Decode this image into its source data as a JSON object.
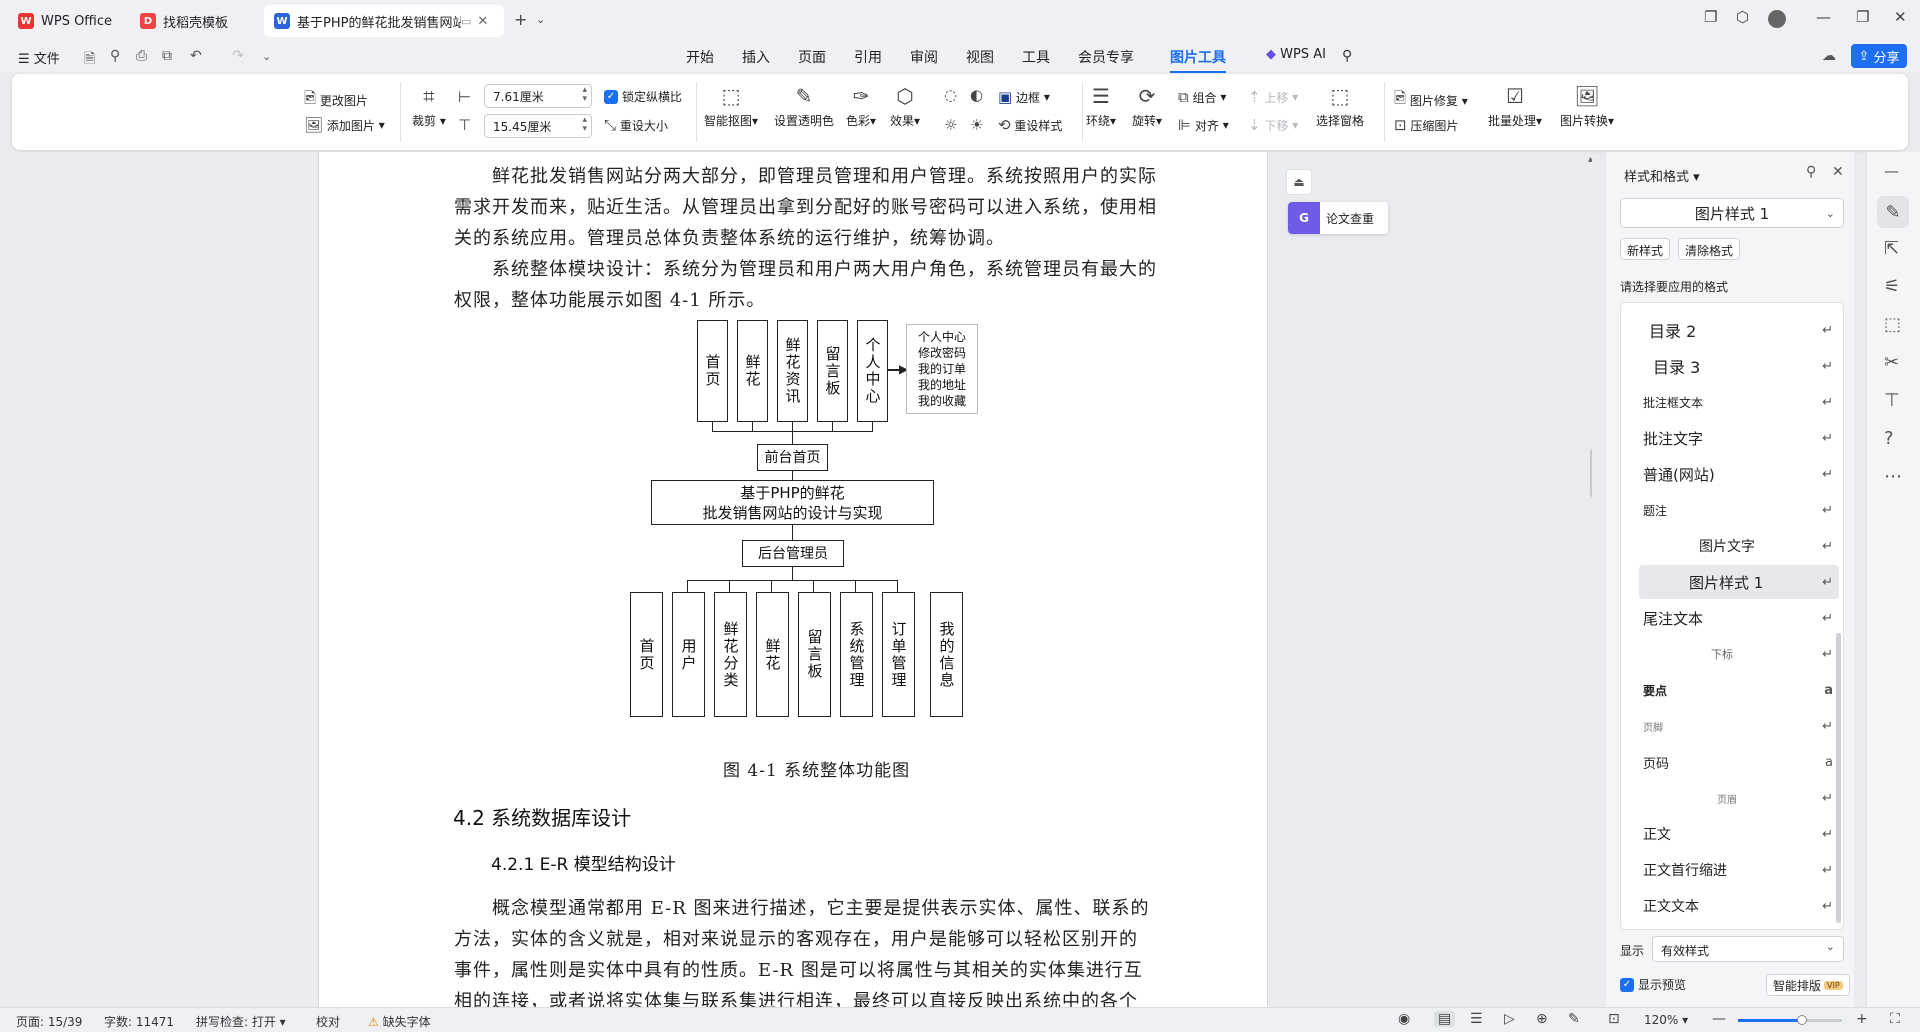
{
  "tabs": [
    {
      "label": "WPS Office",
      "icon": "wps-logo-icon"
    },
    {
      "label": "找稻壳模板",
      "icon": "docer-icon"
    },
    {
      "label": "基于PHP的鲜花批发销售网站的",
      "icon": "word-doc-icon"
    }
  ],
  "menu": {
    "file": "文件",
    "items": [
      "开始",
      "插入",
      "页面",
      "引用",
      "审阅",
      "视图",
      "工具",
      "会员专享",
      "图片工具"
    ],
    "active": "图片工具",
    "wps_ai": "WPS AI",
    "share": "分享"
  },
  "ribbon": {
    "change_image": "更改图片",
    "add_image": "添加图片",
    "crop": "裁剪",
    "width_value": "7.61厘米",
    "height_value": "15.45厘米",
    "lock_ratio": "锁定纵横比",
    "reset_size": "重设大小",
    "smart_matting": "智能抠图",
    "set_transparent": "设置透明色",
    "color": "色彩",
    "effects": "效果",
    "border": "边框",
    "reset_style": "重设样式",
    "wrap": "环绕",
    "rotate": "旋转",
    "group": "组合",
    "align": "对齐",
    "move_up": "上移",
    "move_down": "下移",
    "selection_pane": "选择窗格",
    "image_repair": "图片修复",
    "compress": "压缩图片",
    "batch": "批量处理",
    "convert": "图片转换"
  },
  "document": {
    "para1_line1": "鲜花批发销售网站分两大部分，即管理员管理和用户管理。系统按照用户的实际",
    "para1_line2": "需求开发而来，贴近生活。从管理员出拿到分配好的账号密码可以进入系统，使用相",
    "para1_line3": "关的系统应用。管理员总体负责整体系统的运行维护，统筹协调。",
    "para2_line1": "系统整体模块设计：系统分为管理员和用户两大用户角色，系统管理员有最大的",
    "para2_line2": "权限，整体功能展示如图 4-1 所示。",
    "figure_caption": "图 4-1 系统整体功能图",
    "heading_42": "4.2 系统数据库设计",
    "heading_421": "4.2.1 E-R 模型结构设计",
    "para3_line1": "概念模型通常都用 E-R 图来进行描述，它主要是提供表示实体、属性、联系的",
    "para3_line2": "方法，实体的含义就是，相对来说显示的客观存在，用户是能够可以轻松区别开的",
    "para3_line3": "事件，属性则是实体中具有的性质。E-R 图是可以将属性与其相关的实体集进行互",
    "para3_line4": "相的连接，或者说将实体集与联系集进行相连，最终可以直接反映出系统中的各个"
  },
  "diagram": {
    "top_modules": [
      "首页",
      "鲜花",
      "鲜花资讯",
      "留言板",
      "个人中心"
    ],
    "personal_center_items": [
      "个人中心",
      "修改密码",
      "我的订单",
      "我的地址",
      "我的收藏"
    ],
    "front_page": "前台首页",
    "system_title_line1": "基于PHP的鲜花",
    "system_title_line2": "批发销售网站的设计与实现",
    "admin": "后台管理员",
    "bottom_modules": [
      "首页",
      "用户",
      "鲜花分类",
      "鲜花",
      "留言板",
      "系统管理",
      "订单管理",
      "我的信息"
    ]
  },
  "float_tool": {
    "paper_check": "论文查重"
  },
  "styles_panel": {
    "title": "样式和格式",
    "current_style": "图片样式 1",
    "new_style": "新样式",
    "clear_format": "清除格式",
    "prompt": "请选择要应用的格式",
    "items": [
      "目录 2",
      "目录 3",
      "批注框文本",
      "批注文字",
      "普通(网站)",
      "题注",
      "图片文字",
      "图片样式 1",
      "尾注文本",
      "下标",
      "要点",
      "页脚",
      "页码",
      "页眉",
      "正文",
      "正文首行缩进",
      "正文文本"
    ],
    "show_label": "显示",
    "show_value": "有效样式",
    "show_preview": "显示预览",
    "smart_layout": "智能排版",
    "vip": "VIP"
  },
  "status": {
    "page": "页面: 15/39",
    "words": "字数: 11471",
    "spellcheck": "拼写检查: 打开",
    "proofread": "校对",
    "missing_font": "缺失字体",
    "zoom": "120%"
  }
}
